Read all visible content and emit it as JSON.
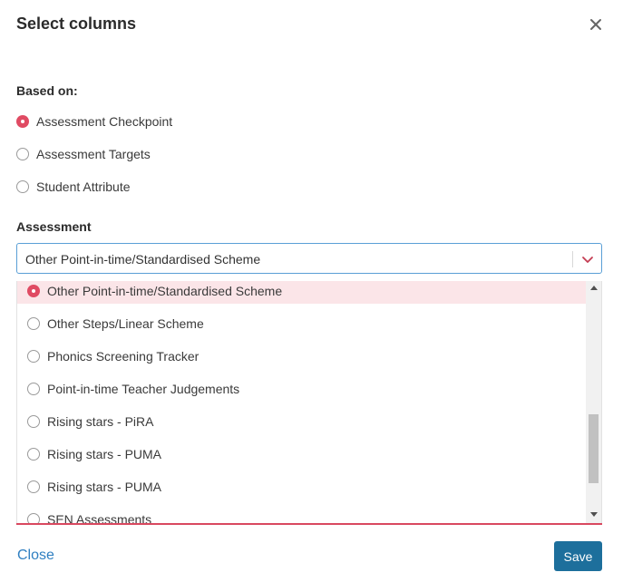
{
  "modal": {
    "title": "Select columns",
    "close_icon": "close-icon"
  },
  "based_on": {
    "label": "Based on:",
    "options": [
      {
        "label": "Assessment Checkpoint",
        "checked": true
      },
      {
        "label": "Assessment Targets",
        "checked": false
      },
      {
        "label": "Student Attribute",
        "checked": false
      }
    ]
  },
  "assessment": {
    "label": "Assessment",
    "selected_value": "Other Point-in-time/Standardised Scheme",
    "chevron_icon": "chevron-down-icon",
    "options": [
      {
        "label": "Other Point-in-time/Standardised Scheme",
        "selected": true
      },
      {
        "label": "Other Steps/Linear Scheme",
        "selected": false
      },
      {
        "label": "Phonics Screening Tracker",
        "selected": false
      },
      {
        "label": "Point-in-time Teacher Judgements",
        "selected": false
      },
      {
        "label": "Rising stars - PiRA",
        "selected": false
      },
      {
        "label": "Rising stars - PUMA",
        "selected": false
      },
      {
        "label": "Rising stars - PUMA",
        "selected": false
      },
      {
        "label": "SEN Assessments",
        "selected": false
      }
    ]
  },
  "footer": {
    "close_label": "Close",
    "save_label": "Save"
  },
  "colors": {
    "accent": "#e04b63",
    "selected_bg": "#fbe5e8",
    "link": "#2f7fc1",
    "primary_button": "#1d6f9c",
    "focus_border": "#5a9fd6"
  }
}
